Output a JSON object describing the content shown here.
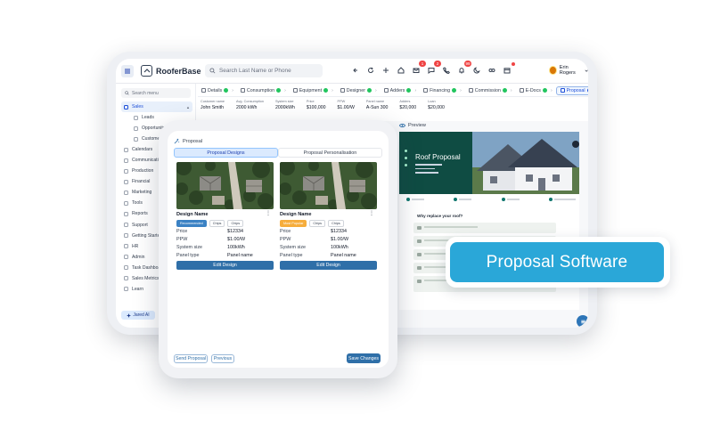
{
  "app": {
    "brand": "RooferBase",
    "search_placeholder": "Search Last Name or Phone",
    "notification_counts": [
      "1",
      "2",
      "99"
    ],
    "user_name": "Erin Rogers"
  },
  "sidebar": {
    "search_placeholder": "Search menu",
    "items": [
      {
        "label": "Sales",
        "active": true,
        "sub": false,
        "expand": true
      },
      {
        "label": "Leads",
        "sub": true
      },
      {
        "label": "Opportunity",
        "sub": true
      },
      {
        "label": "Customer",
        "sub": true
      },
      {
        "label": "Calendars",
        "sub": false
      },
      {
        "label": "Communication",
        "sub": false
      },
      {
        "label": "Production",
        "sub": false,
        "expand": true
      },
      {
        "label": "Financial",
        "sub": false,
        "expand": true
      },
      {
        "label": "Marketing",
        "sub": false
      },
      {
        "label": "Tools",
        "sub": false
      },
      {
        "label": "Reports",
        "sub": false
      },
      {
        "label": "Support",
        "sub": false
      },
      {
        "label": "Getting Started",
        "sub": false
      },
      {
        "label": "HR",
        "sub": false
      },
      {
        "label": "Admin",
        "sub": false
      },
      {
        "label": "Task Dashboard",
        "sub": false
      },
      {
        "label": "Sales Metrics",
        "sub": false
      },
      {
        "label": "Learn",
        "sub": false
      }
    ],
    "assistant_button": "Jared AI"
  },
  "steps": [
    {
      "label": "Details",
      "done": true
    },
    {
      "label": "Consumption",
      "done": true
    },
    {
      "label": "Equipment",
      "done": true
    },
    {
      "label": "Designer",
      "done": true
    },
    {
      "label": "Adders",
      "done": true
    },
    {
      "label": "Financing",
      "done": true
    },
    {
      "label": "Commission",
      "done": true
    },
    {
      "label": "E-Docs",
      "done": true
    },
    {
      "label": "Proposal",
      "done": false,
      "active": true
    }
  ],
  "params": [
    {
      "label": "Customer name",
      "value": "John Smith"
    },
    {
      "label": "Avg. Consumption",
      "value": "2000 kWh"
    },
    {
      "label": "System size",
      "value": "2000kWh"
    },
    {
      "label": "Price",
      "value": "$100,000"
    },
    {
      "label": "PPW",
      "value": "$1.00/W"
    },
    {
      "label": "Panel name",
      "value": "A-Sun 300"
    },
    {
      "label": "Adders",
      "value": "$20,000"
    },
    {
      "label": "Loan",
      "value": "$20,000"
    }
  ],
  "preview": {
    "heading": "Preview",
    "title": "Roof Proposal",
    "why_heading": "Why replace your roof?"
  },
  "proposal_panel": {
    "heading": "Proposal",
    "tabs": [
      "Proposal Designs",
      "Proposal Personalisation"
    ],
    "designs": [
      {
        "name": "Design Name",
        "tags": [
          {
            "label": "Recommended",
            "kind": "rec"
          },
          {
            "label": "Chips",
            "kind": "plain"
          },
          {
            "label": "Chips",
            "kind": "plain"
          }
        ],
        "rows": [
          {
            "label": "Price",
            "value": "$12334"
          },
          {
            "label": "PPW",
            "value": "$1.00/W"
          },
          {
            "label": "System size",
            "value": "100kWh"
          },
          {
            "label": "Panel type",
            "value": "Panel name"
          }
        ],
        "button": "Edit Design"
      },
      {
        "name": "Design Name",
        "tags": [
          {
            "label": "Most Popular",
            "kind": "mod"
          },
          {
            "label": "Chips",
            "kind": "plain"
          },
          {
            "label": "Chips",
            "kind": "plain"
          }
        ],
        "rows": [
          {
            "label": "Price",
            "value": "$12334"
          },
          {
            "label": "PPW",
            "value": "$1.00/W"
          },
          {
            "label": "System size",
            "value": "100kWh"
          },
          {
            "label": "Panel type",
            "value": "Panel name"
          }
        ],
        "button": "Edit Design"
      }
    ],
    "footer": {
      "send": "Send Proposal",
      "previous": "Previous",
      "save": "Save Changes"
    }
  },
  "callout": {
    "text": "Proposal Software"
  },
  "colors": {
    "primary": "#2f6fa8",
    "accent": "#2aa7d8",
    "success": "#22c55e",
    "badge": "#ef4444",
    "hero": "#0f4c43"
  },
  "icons": [
    "menu-icon",
    "search-icon",
    "back-icon",
    "refresh-icon",
    "plus-icon",
    "home-icon",
    "mail-icon",
    "chat-icon",
    "phone-icon",
    "bell-icon",
    "moon-icon",
    "link-icon",
    "calendar-icon",
    "check-icon",
    "kebab-icon",
    "sparkle-icon",
    "eye-icon"
  ]
}
